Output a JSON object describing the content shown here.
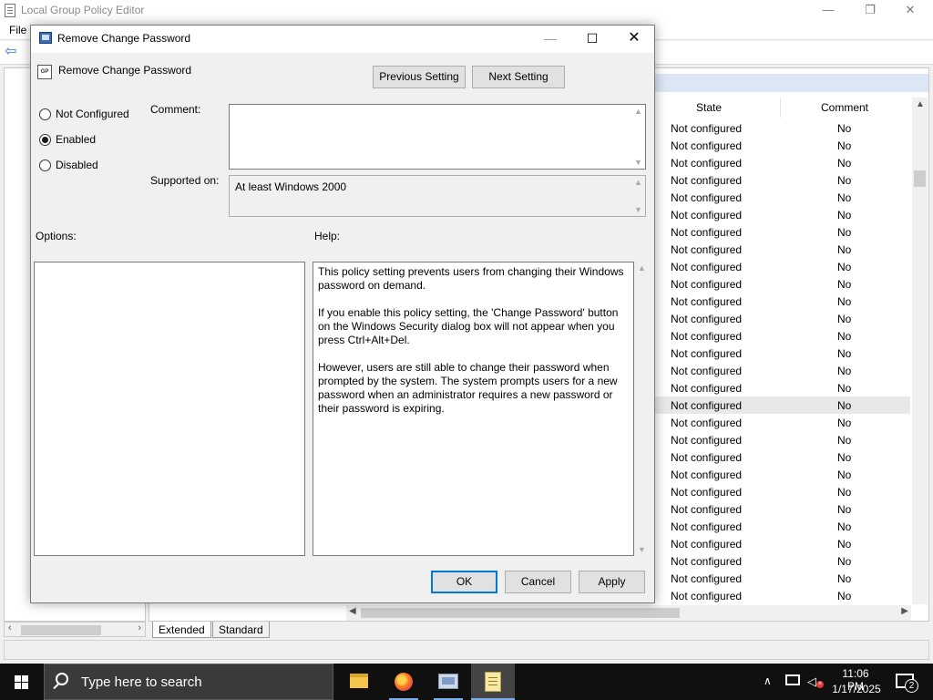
{
  "gpe": {
    "title": "Local Group Policy Editor",
    "menu_file": "File",
    "columns": {
      "state": "State",
      "comment": "Comment"
    },
    "rows": [
      {
        "state": "Not configured",
        "comment": "No"
      },
      {
        "state": "Not configured",
        "comment": "No"
      },
      {
        "state": "Not configured",
        "comment": "No"
      },
      {
        "state": "Not configured",
        "comment": "No"
      },
      {
        "state": "Not configured",
        "comment": "No"
      },
      {
        "state": "Not configured",
        "comment": "No"
      },
      {
        "state": "Not configured",
        "comment": "No"
      },
      {
        "state": "Not configured",
        "comment": "No"
      },
      {
        "state": "Not configured",
        "comment": "No"
      },
      {
        "state": "Not configured",
        "comment": "No"
      },
      {
        "state": "Not configured",
        "comment": "No"
      },
      {
        "state": "Not configured",
        "comment": "No"
      },
      {
        "state": "Not configured",
        "comment": "No"
      },
      {
        "state": "Not configured",
        "comment": "No"
      },
      {
        "state": "Not configured",
        "comment": "No"
      },
      {
        "state": "Not configured",
        "comment": "No"
      },
      {
        "state": "Not configured",
        "comment": "No"
      },
      {
        "state": "Not configured",
        "comment": "No"
      },
      {
        "state": "Not configured",
        "comment": "No"
      },
      {
        "state": "Not configured",
        "comment": "No"
      },
      {
        "state": "Not configured",
        "comment": "No"
      },
      {
        "state": "Not configured",
        "comment": "No"
      },
      {
        "state": "Not configured",
        "comment": "No"
      },
      {
        "state": "Not configured",
        "comment": "No"
      },
      {
        "state": "Not configured",
        "comment": "No"
      },
      {
        "state": "Not configured",
        "comment": "No"
      },
      {
        "state": "Not configured",
        "comment": "No"
      },
      {
        "state": "Not configured",
        "comment": "No"
      }
    ],
    "tabs": {
      "extended": "Extended",
      "standard": "Standard"
    }
  },
  "dialog": {
    "title": "Remove Change Password",
    "policy_name": "Remove Change Password",
    "previous_setting": "Previous Setting",
    "next_setting": "Next Setting",
    "radio_not_configured": "Not Configured",
    "radio_enabled": "Enabled",
    "radio_disabled": "Disabled",
    "selected_option": "Enabled",
    "comment_label": "Comment:",
    "comment_value": "",
    "supported_on_label": "Supported on:",
    "supported_on_value": "At least Windows 2000",
    "options_label": "Options:",
    "help_label": "Help:",
    "help_paragraphs": [
      "This policy setting prevents users from changing their Windows password on demand.",
      "If you enable this policy setting,  the 'Change Password' button on the Windows Security dialog box will not appear when you press Ctrl+Alt+Del.",
      "However, users are still able to change their password when prompted by the system. The system prompts users for a new password when an administrator requires a new password or their password is expiring."
    ],
    "ok": "OK",
    "cancel": "Cancel",
    "apply": "Apply"
  },
  "taskbar": {
    "search_placeholder": "Type here to search",
    "time": "11:06 PM",
    "date": "1/17/2025",
    "notification_count": "2"
  },
  "colors": {
    "accent": "#0078d7",
    "taskbar": "#101010"
  }
}
